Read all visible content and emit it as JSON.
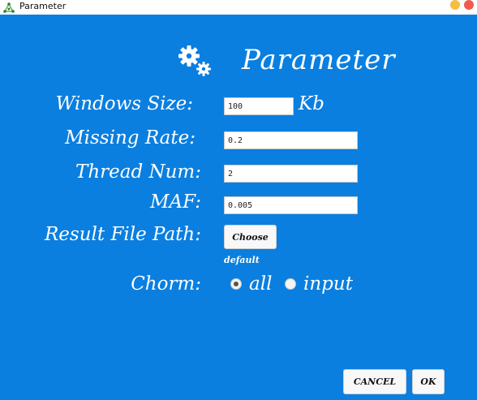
{
  "window": {
    "title": "Parameter",
    "app_icon": "network-icon"
  },
  "header": {
    "icon": "gears-icon",
    "title": "Parameter"
  },
  "form": {
    "window_size": {
      "label": "Windows Size:",
      "value": "100",
      "unit": "Kb"
    },
    "missing_rate": {
      "label": "Missing Rate:",
      "value": "0.2"
    },
    "thread_num": {
      "label": "Thread Num:",
      "value": "2"
    },
    "maf": {
      "label": "MAF:",
      "value": "0.005"
    },
    "result_path": {
      "label": "Result File Path:",
      "button": "Choose",
      "hint": "default"
    },
    "chorm": {
      "label": "Chorm:",
      "options": [
        "all",
        "input"
      ],
      "selected": "all"
    }
  },
  "footer": {
    "cancel": "CANCEL",
    "ok": "OK"
  },
  "colors": {
    "background": "#0a7fe0",
    "text": "#ffffff",
    "minimize": "#f7bd3e",
    "close": "#f15a4e"
  }
}
